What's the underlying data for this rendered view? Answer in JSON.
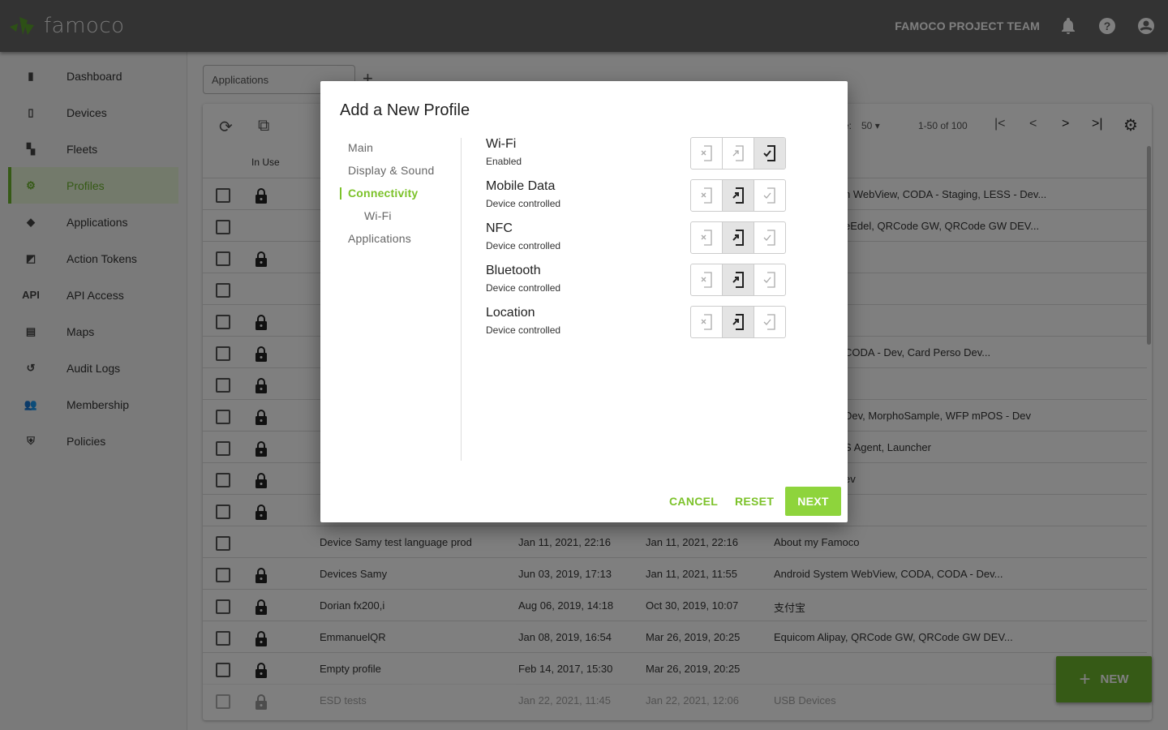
{
  "header": {
    "logo": "famoco",
    "team": "FAMOCO PROJECT TEAM",
    "icons": [
      "bell-icon",
      "help-icon",
      "account-icon"
    ]
  },
  "sidebar": {
    "items": [
      {
        "label": "Dashboard",
        "icon": "dashboard-icon",
        "glyph": "▮"
      },
      {
        "label": "Devices",
        "icon": "device-icon",
        "glyph": "▯"
      },
      {
        "label": "Fleets",
        "icon": "fleets-icon",
        "glyph": "▚"
      },
      {
        "label": "Profiles",
        "icon": "profile-icon",
        "glyph": "⚙",
        "active": true
      },
      {
        "label": "Applications",
        "icon": "android-icon",
        "glyph": "◆"
      },
      {
        "label": "Action Tokens",
        "icon": "cast-icon",
        "glyph": "◩"
      },
      {
        "label": "API Access",
        "icon": "api-icon",
        "glyph": "API"
      },
      {
        "label": "Maps",
        "icon": "map-icon",
        "glyph": "▤"
      },
      {
        "label": "Audit Logs",
        "icon": "history-icon",
        "glyph": "↺"
      },
      {
        "label": "Membership",
        "icon": "people-icon",
        "glyph": "👥"
      },
      {
        "label": "Policies",
        "icon": "shield-icon",
        "glyph": "⛨"
      }
    ]
  },
  "main": {
    "tab": "Applications",
    "add_tab": "+",
    "in_use_header": "In Use",
    "rows_per_page": "50",
    "range": "1-50 of 100",
    "rows_label_fragment": "e:",
    "rows": [
      {
        "lock": true,
        "fragment": "n WebView, CODA - Staging, LESS - Dev..."
      },
      {
        "lock": false,
        "fragment": "eEdel, QRCode GW, QRCode GW DEV..."
      },
      {
        "lock": true,
        "fragment": ""
      },
      {
        "lock": false,
        "fragment": ""
      },
      {
        "lock": true,
        "fragment": ""
      },
      {
        "lock": true,
        "fragment": "CODA - Dev, Card Perso Dev..."
      },
      {
        "lock": true,
        "fragment": ""
      },
      {
        "lock": true,
        "fragment": "Dev, MorphoSample, WFP mPOS - Dev"
      },
      {
        "lock": true,
        "fragment": "S Agent, Launcher"
      },
      {
        "lock": true,
        "fragment": "ev"
      },
      {
        "lock": true,
        "fragment": ""
      },
      {
        "lock": false,
        "name": "Device Samy test language prod",
        "created": "Jan 11, 2021, 22:16",
        "modified": "Jan 11, 2021, 22:16",
        "apps": "About my Famoco"
      },
      {
        "lock": true,
        "name": "Devices Samy",
        "created": "Jun 03, 2019, 17:13",
        "modified": "Jan 11, 2021, 11:55",
        "apps": "Android System WebView, CODA, CODA - Dev..."
      },
      {
        "lock": true,
        "name": "Dorian fx200,i",
        "created": "Aug 06, 2019, 14:18",
        "modified": "Oct 30, 2019, 10:07",
        "apps": "支付宝"
      },
      {
        "lock": true,
        "name": "EmmanuelQR",
        "created": "Jan 08, 2019, 16:54",
        "modified": "Mar 26, 2019, 20:25",
        "apps": "Equicom Alipay, QRCode GW, QRCode GW DEV..."
      },
      {
        "lock": true,
        "name": "Empty profile",
        "created": "Feb 14, 2017, 15:30",
        "modified": "Mar 26, 2019, 20:25",
        "apps": ""
      },
      {
        "lock": true,
        "name": "ESD tests",
        "created": "Jan 22, 2021, 11:45",
        "modified": "Jan 22, 2021, 12:06",
        "apps": "USB Devices",
        "faded": true
      }
    ],
    "new_button": "NEW"
  },
  "modal": {
    "title": "Add a New Profile",
    "nav": [
      {
        "label": "Main"
      },
      {
        "label": "Display & Sound"
      },
      {
        "label": "Connectivity",
        "active": true
      },
      {
        "label": "Wi-Fi",
        "sub": true
      },
      {
        "label": "Applications"
      }
    ],
    "settings": [
      {
        "title": "Wi-Fi",
        "status": "Enabled",
        "selected": 2
      },
      {
        "title": "Mobile Data",
        "status": "Device controlled",
        "selected": 1
      },
      {
        "title": "NFC",
        "status": "Device controlled",
        "selected": 1
      },
      {
        "title": "Bluetooth",
        "status": "Device controlled",
        "selected": 1
      },
      {
        "title": "Location",
        "status": "Device controlled",
        "selected": 1
      }
    ],
    "options": [
      "disabled-icon",
      "device-controlled-icon",
      "enabled-icon"
    ],
    "cancel": "CANCEL",
    "reset": "RESET",
    "next": "NEXT"
  },
  "colors": {
    "accent": "#7cc22a",
    "fab": "#6cb52d"
  }
}
